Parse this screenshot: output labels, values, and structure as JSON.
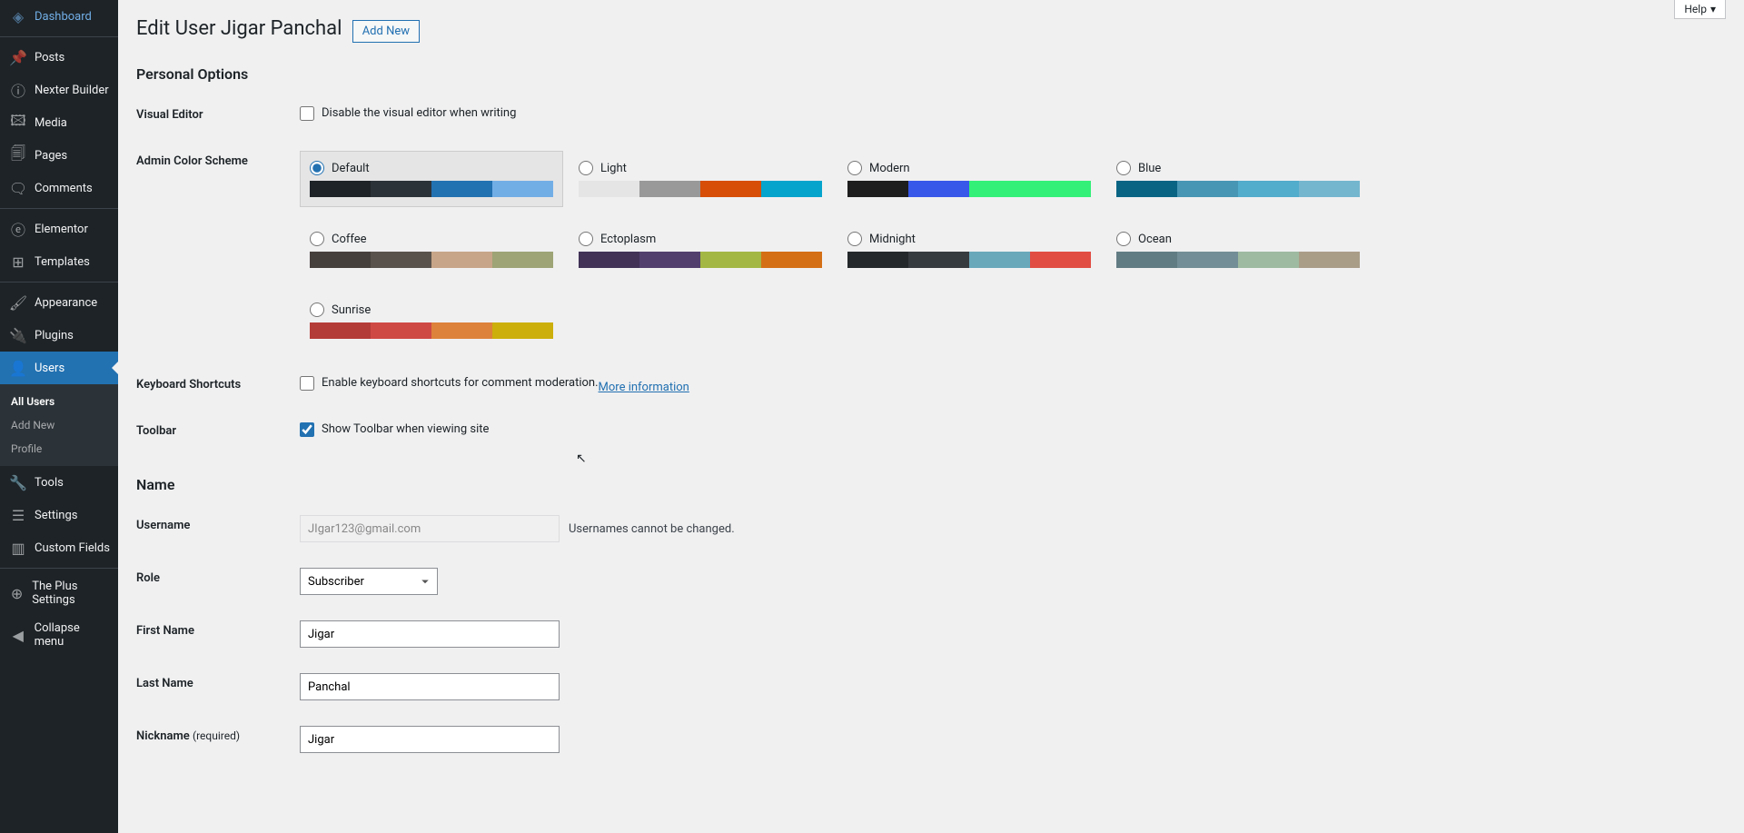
{
  "sidebar": {
    "items": [
      {
        "id": "dashboard",
        "label": "Dashboard",
        "icon": "◈"
      },
      {
        "id": "posts",
        "label": "Posts",
        "icon": "📌"
      },
      {
        "id": "nexter",
        "label": "Nexter Builder",
        "icon": "ⓘ"
      },
      {
        "id": "media",
        "label": "Media",
        "icon": "🖾"
      },
      {
        "id": "pages",
        "label": "Pages",
        "icon": "🗐"
      },
      {
        "id": "comments",
        "label": "Comments",
        "icon": "🗨"
      },
      {
        "id": "elementor",
        "label": "Elementor",
        "icon": "ⓔ"
      },
      {
        "id": "templates",
        "label": "Templates",
        "icon": "⊞"
      },
      {
        "id": "appearance",
        "label": "Appearance",
        "icon": "🖌"
      },
      {
        "id": "plugins",
        "label": "Plugins",
        "icon": "🔌"
      },
      {
        "id": "users",
        "label": "Users",
        "icon": "👤"
      },
      {
        "id": "tools",
        "label": "Tools",
        "icon": "🔧"
      },
      {
        "id": "settings",
        "label": "Settings",
        "icon": "☰"
      },
      {
        "id": "custom-fields",
        "label": "Custom Fields",
        "icon": "▥"
      },
      {
        "id": "plus",
        "label": "The Plus Settings",
        "icon": "⊕"
      },
      {
        "id": "collapse",
        "label": "Collapse menu",
        "icon": "◀"
      }
    ],
    "submenu": {
      "all_users": "All Users",
      "add_new": "Add New",
      "profile": "Profile"
    }
  },
  "header": {
    "title": "Edit User Jigar Panchal",
    "add_new": "Add New",
    "help": "Help"
  },
  "sections": {
    "personal_options": "Personal Options",
    "name": "Name"
  },
  "personal": {
    "visual_editor_label": "Visual Editor",
    "visual_editor_cb": "Disable the visual editor when writing",
    "color_scheme_label": "Admin Color Scheme",
    "keyboard_label": "Keyboard Shortcuts",
    "keyboard_cb": "Enable keyboard shortcuts for comment moderation. ",
    "keyboard_link": "More information",
    "toolbar_label": "Toolbar",
    "toolbar_cb": "Show Toolbar when viewing site"
  },
  "schemes": [
    {
      "name": "Default",
      "colors": [
        "#1d2327",
        "#2c3338",
        "#2271b1",
        "#72aee6"
      ],
      "selected": true
    },
    {
      "name": "Light",
      "colors": [
        "#e5e5e5",
        "#999999",
        "#d64e07",
        "#04a4cc"
      ]
    },
    {
      "name": "Modern",
      "colors": [
        "#1e1e1e",
        "#3858e9",
        "#33f078",
        "#33f078"
      ]
    },
    {
      "name": "Blue",
      "colors": [
        "#096484",
        "#4796b3",
        "#52accc",
        "#74b6ce"
      ]
    },
    {
      "name": "Coffee",
      "colors": [
        "#46403c",
        "#59524c",
        "#c7a589",
        "#9ea476"
      ]
    },
    {
      "name": "Ectoplasm",
      "colors": [
        "#413256",
        "#523f6d",
        "#a3b745",
        "#d46f15"
      ]
    },
    {
      "name": "Midnight",
      "colors": [
        "#25282b",
        "#363b3f",
        "#69a8bb",
        "#e14d43"
      ]
    },
    {
      "name": "Ocean",
      "colors": [
        "#627c83",
        "#738e96",
        "#9ebaa0",
        "#aa9d88"
      ]
    },
    {
      "name": "Sunrise",
      "colors": [
        "#b43c38",
        "#cf4944",
        "#dd823b",
        "#ccaf0b"
      ]
    }
  ],
  "name_form": {
    "username_label": "Username",
    "username_value": "JIgar123@gmail.com",
    "username_desc": "Usernames cannot be changed.",
    "role_label": "Role",
    "role_value": "Subscriber",
    "first_name_label": "First Name",
    "first_name_value": "Jigar",
    "last_name_label": "Last Name",
    "last_name_value": "Panchal",
    "nickname_label": "Nickname ",
    "nickname_req": "(required)",
    "nickname_value": "Jigar"
  }
}
